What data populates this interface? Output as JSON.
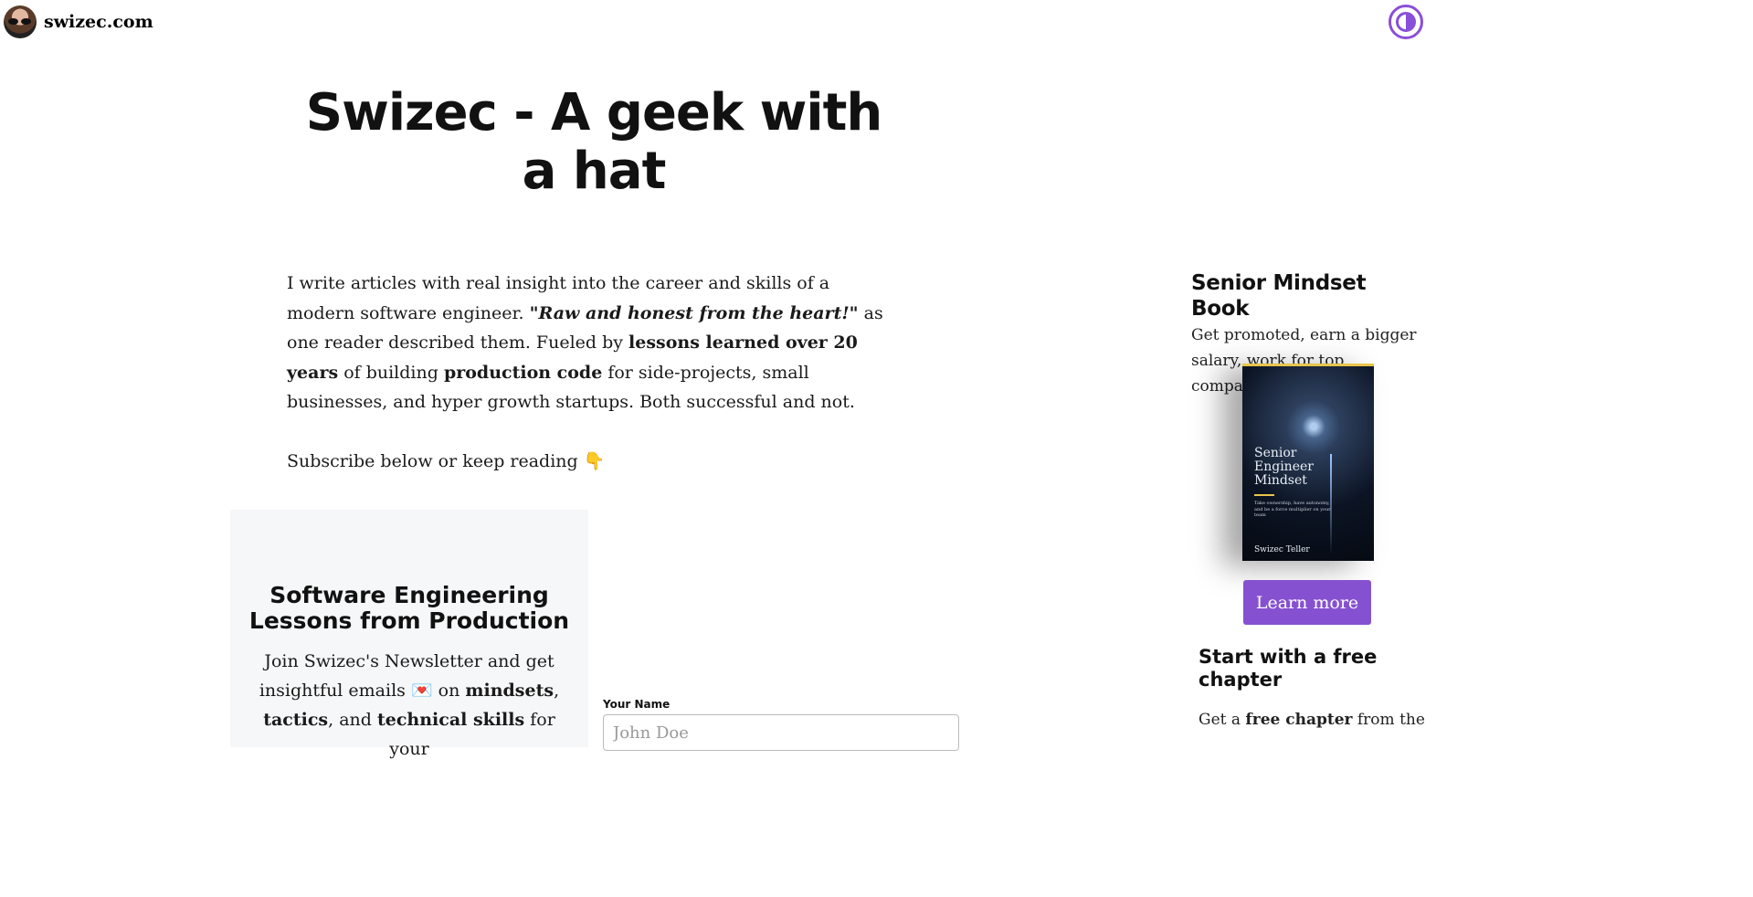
{
  "header": {
    "site_name": "swizec.com",
    "avatar_icon": "avatar-photo",
    "theme_icon": "contrast-half-circle-icon"
  },
  "page": {
    "title": "Swizec - A geek with a hat"
  },
  "intro": {
    "part1": "I write articles with real insight into the career and skills of a modern software engineer. ",
    "quote": "\"Raw and honest from the heart!\"",
    "part2": " as one reader described them. Fueled by ",
    "bold1": "lessons learned over 20 years",
    "part3": " of building ",
    "bold2": "production code",
    "part4": " for side-projects, small businesses, and hyper growth startups. Both successful and not.",
    "cta": "Subscribe below or keep reading",
    "cta_emoji": "👇"
  },
  "newsletter": {
    "title": "Software Engineering Lessons from Production",
    "desc_part1": "Join Swizec's Newsletter and get insightful emails ",
    "desc_emoji": "💌",
    "desc_part2": " on ",
    "bold_mindsets": "mindsets",
    "comma": ",",
    "bold_tactics": "tactics",
    "and": ", and ",
    "bold_skills": "technical skills",
    "desc_part3": " for your"
  },
  "form": {
    "name_label": "Your Name",
    "name_placeholder": "John Doe"
  },
  "sidebar": {
    "book_heading": "Senior Mindset Book",
    "book_desc": "Get promoted, earn a bigger salary, work for top companies",
    "cover_title": "Senior\nEngineer\nMindset",
    "cover_sub": "Take ownership, have autonomy, and be a force multiplier on your team",
    "cover_author": "Swizec Teller",
    "learn_more": "Learn more",
    "chapter_heading": "Start with a free chapter",
    "chapter_part1": "Get a ",
    "chapter_bold": "free chapter",
    "chapter_part2": " from the"
  },
  "colors": {
    "accent": "#8651d1",
    "newsletter_bg": "#f6f7f9",
    "book_gold": "#e8c44a"
  }
}
